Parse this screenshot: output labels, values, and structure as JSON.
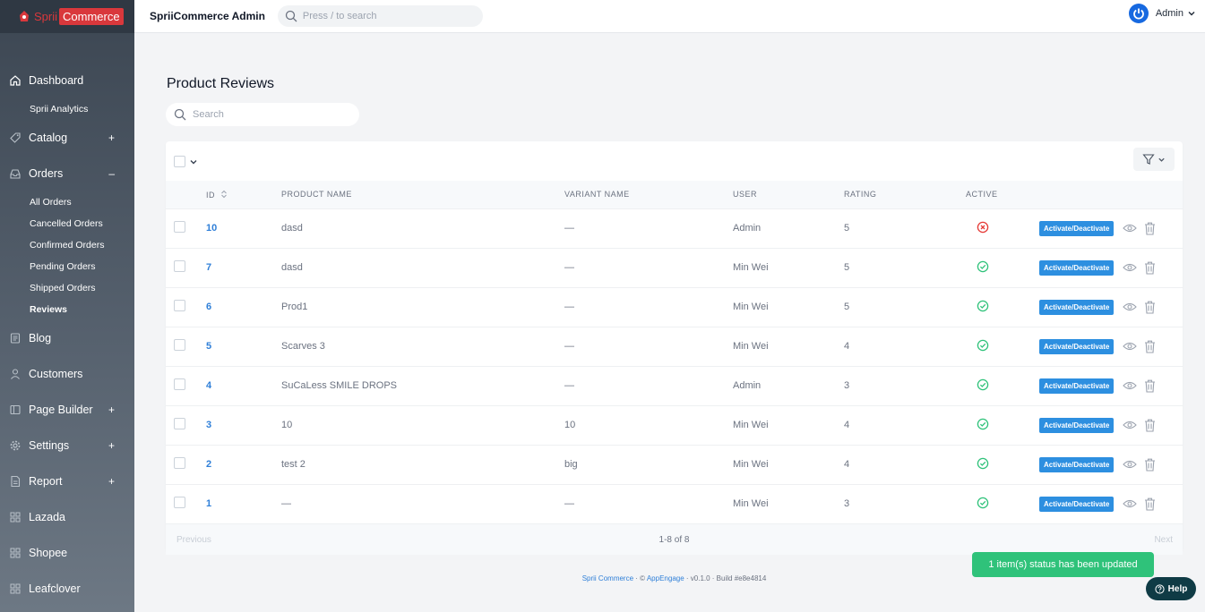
{
  "brand": {
    "part1": "Sprii",
    "part2": "Commerce"
  },
  "topbar": {
    "title": "SpriiCommerce Admin",
    "search_placeholder": "Press / to search",
    "user": "Admin"
  },
  "sidebar": {
    "items": [
      {
        "label": "Dashboard",
        "icon": "home-icon"
      },
      {
        "label": "Sprii Analytics",
        "sub": true
      },
      {
        "label": "Catalog",
        "icon": "tag-icon",
        "toggle": "+"
      },
      {
        "label": "Orders",
        "icon": "inbox-icon",
        "toggle": "–"
      },
      {
        "label": "All Orders",
        "sub": true
      },
      {
        "label": "Cancelled Orders",
        "sub": true
      },
      {
        "label": "Confirmed Orders",
        "sub": true
      },
      {
        "label": "Pending Orders",
        "sub": true
      },
      {
        "label": "Shipped Orders",
        "sub": true
      },
      {
        "label": "Reviews",
        "sub": true,
        "active": true
      },
      {
        "label": "Blog",
        "icon": "blog-icon"
      },
      {
        "label": "Customers",
        "icon": "user-icon"
      },
      {
        "label": "Page Builder",
        "icon": "page-builder-icon",
        "toggle": "+"
      },
      {
        "label": "Settings",
        "icon": "gear-icon",
        "toggle": "+"
      },
      {
        "label": "Report",
        "icon": "report-icon",
        "toggle": "+"
      },
      {
        "label": "Lazada",
        "icon": "grid-icon"
      },
      {
        "label": "Shopee",
        "icon": "grid-icon"
      },
      {
        "label": "Leafclover",
        "icon": "grid-icon"
      }
    ]
  },
  "main": {
    "title": "Product Reviews",
    "search_placeholder": "Search",
    "table": {
      "columns": [
        "ID",
        "PRODUCT NAME",
        "VARIANT NAME",
        "USER",
        "RATING",
        "ACTIVE"
      ],
      "action_label": "Activate/Deactivate",
      "rows": [
        {
          "id": "10",
          "product": "dasd",
          "variant": "—",
          "user": "Admin",
          "rating": "5",
          "active": false
        },
        {
          "id": "7",
          "product": "dasd",
          "variant": "—",
          "user": "Min Wei",
          "rating": "5",
          "active": true
        },
        {
          "id": "6",
          "product": "Prod1",
          "variant": "—",
          "user": "Min Wei",
          "rating": "5",
          "active": true
        },
        {
          "id": "5",
          "product": "Scarves 3",
          "variant": "—",
          "user": "Min Wei",
          "rating": "4",
          "active": true
        },
        {
          "id": "4",
          "product": "SuCaLess SMILE DROPS",
          "variant": "—",
          "user": "Admin",
          "rating": "3",
          "active": true
        },
        {
          "id": "3",
          "product": "10",
          "variant": "10",
          "user": "Min Wei",
          "rating": "4",
          "active": true
        },
        {
          "id": "2",
          "product": "test 2",
          "variant": "big",
          "user": "Min Wei",
          "rating": "4",
          "active": true
        },
        {
          "id": "1",
          "product": "—",
          "variant": "—",
          "user": "Min Wei",
          "rating": "3",
          "active": true
        }
      ]
    },
    "pagination": {
      "prev": "Previous",
      "count": "1-8 of 8",
      "next": "Next"
    }
  },
  "footer": {
    "brand": "Sprii Commerce",
    "sep1": " · © ",
    "company": "AppEngage",
    "rest": " · v0.1.0 · Build #e8e4814"
  },
  "toast": "1 item(s) status has been updated",
  "help": "Help",
  "colors": {
    "accent": "#2d8fe0",
    "success": "#2fc27a",
    "danger": "#e53935",
    "brand": "#d9383c"
  }
}
